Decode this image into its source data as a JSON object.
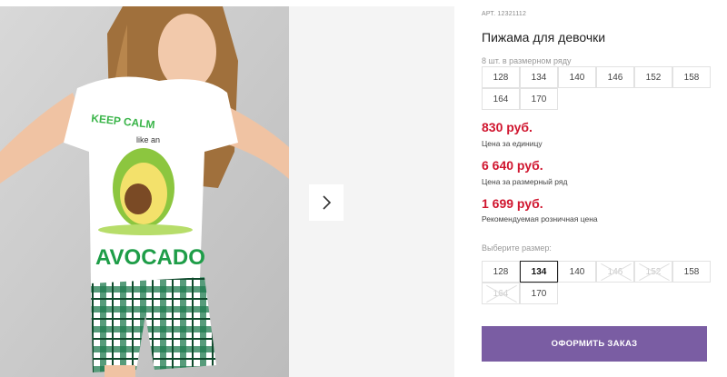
{
  "product": {
    "sku": "АРТ. 12321112",
    "title": "Пижама для девочки",
    "pack_note": "8 шт. в размерном ряду",
    "pack_sizes": [
      "128",
      "134",
      "140",
      "146",
      "152",
      "158",
      "164",
      "170"
    ]
  },
  "gallery": {
    "shirt_text_top": "KEEP CALM",
    "shirt_text_mid": "like an",
    "shirt_text_bottom": "AVOCADO",
    "next_icon": "chevron-right-icon"
  },
  "prices": [
    {
      "value": "830 руб.",
      "note": "Цена за единицу"
    },
    {
      "value": "6 640 руб.",
      "note": "Цена за размерный ряд"
    },
    {
      "value": "1 699 руб.",
      "note": "Рекомендуемая розничная цена"
    }
  ],
  "size_picker": {
    "label": "Выберите размер:",
    "sizes": [
      {
        "label": "128",
        "state": "available"
      },
      {
        "label": "134",
        "state": "selected"
      },
      {
        "label": "140",
        "state": "available"
      },
      {
        "label": "146",
        "state": "unavailable"
      },
      {
        "label": "152",
        "state": "unavailable"
      },
      {
        "label": "158",
        "state": "available"
      },
      {
        "label": "164",
        "state": "unavailable"
      },
      {
        "label": "170",
        "state": "available"
      }
    ]
  },
  "order_button": {
    "label": "ОФОРМИТЬ ЗАКАЗ"
  },
  "colors": {
    "price": "#d0162f",
    "button": "#7a5da3"
  }
}
